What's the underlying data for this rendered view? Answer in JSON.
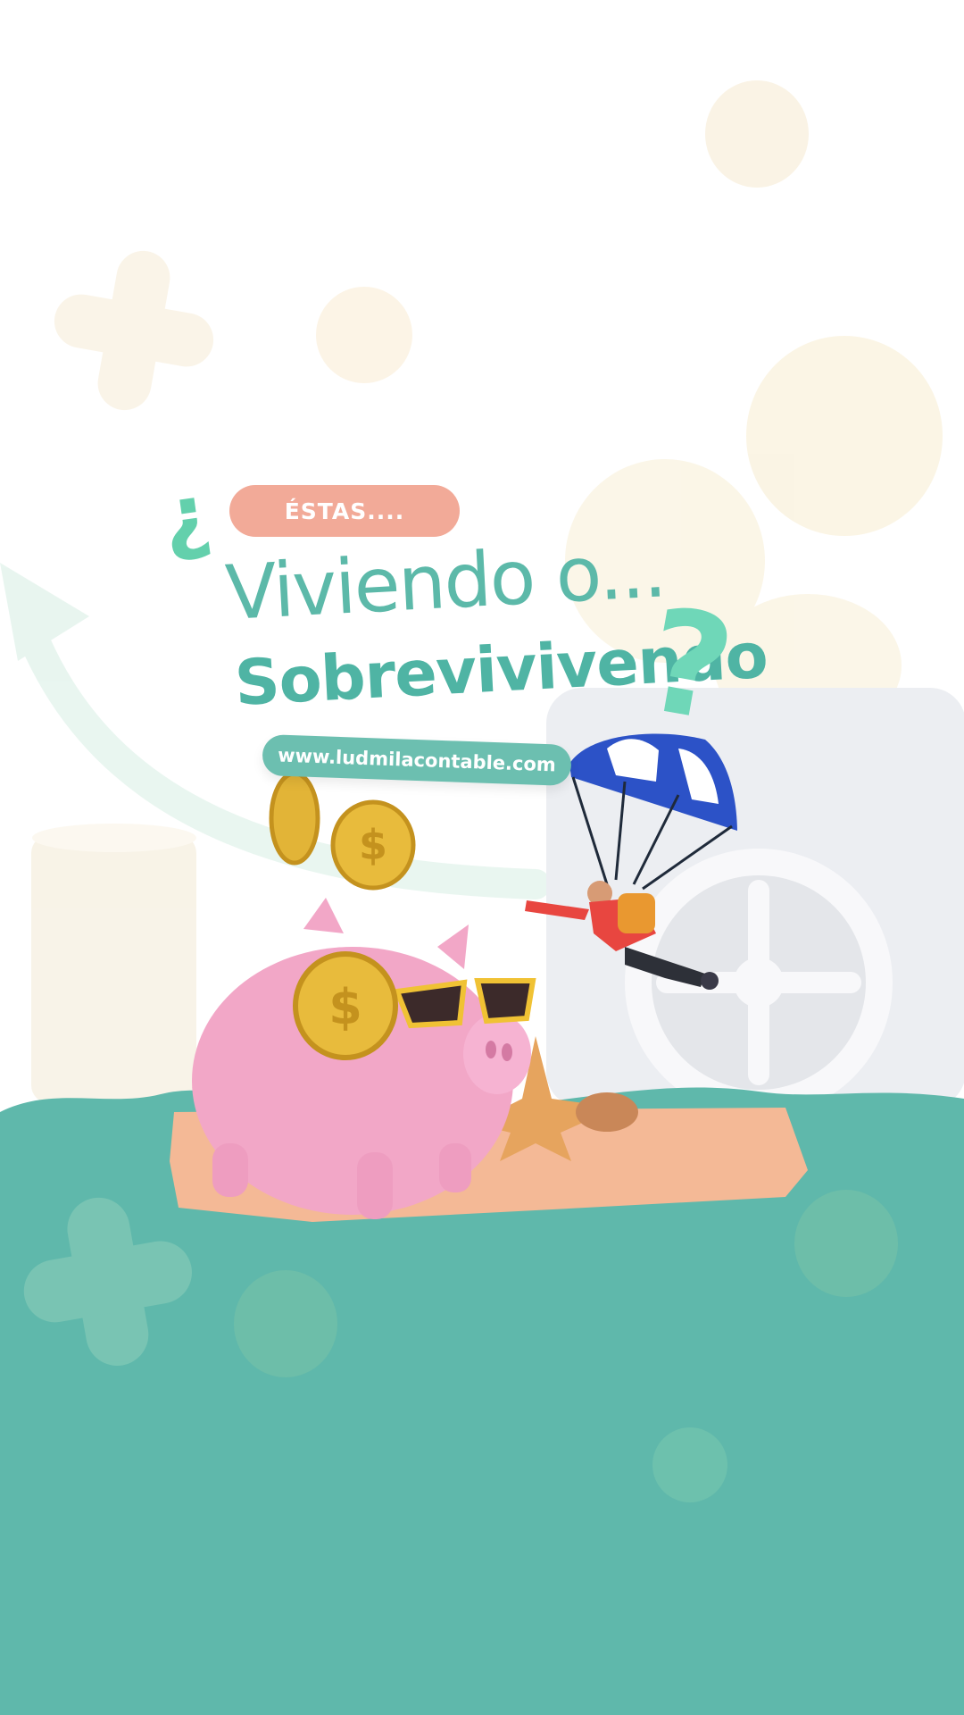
{
  "badge": {
    "text": "ÉSTAS...."
  },
  "inverted_question_mark": "¿",
  "headline": {
    "line1": "Viviendo o...",
    "line2": "Sobrevivivendo",
    "question_mark": "?"
  },
  "website": "www.ludmilacontable.com",
  "colors": {
    "teal": "#5fb8ab",
    "mint": "#6fd7b8",
    "salmon": "#f2aa98",
    "cream": "#f8f1dc",
    "pink": "#f0a6c6",
    "gold": "#e2b437",
    "sand": "#f4b996"
  },
  "icons": [
    "piggy-bank-icon",
    "coin-icon",
    "plus-icon",
    "safe-icon",
    "parachute-icon",
    "sunglasses-icon",
    "starfish-icon",
    "arrow-icon"
  ]
}
